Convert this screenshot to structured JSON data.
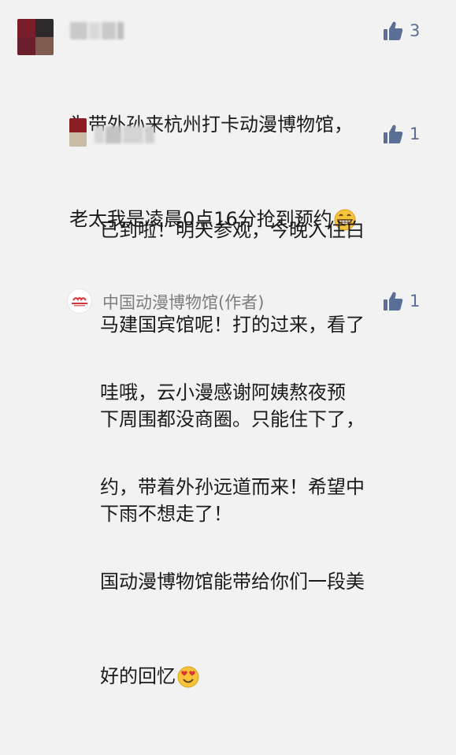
{
  "comments": [
    {
      "like_count": "3",
      "lines": [
        "为带外孙来杭州打卡动漫博物馆，",
        "老太我是凌晨0点16分抢到预约"
      ],
      "emoji": "grinning-emoji"
    },
    {
      "like_count": "1",
      "lines": [
        "已到啦！明天参观，今晚入住白",
        "马建国宾馆呢！打的过来，看了",
        "下周围都没商圈。只能住下了，",
        "下雨不想走了！"
      ]
    },
    {
      "author": "中国动漫博物馆(作者)",
      "like_count": "1",
      "lines": [
        "哇哦，云小漫感谢阿姨熬夜预",
        "约，带着外孙远道而来！希望中",
        "国动漫博物馆能带给你们一段美",
        "好的回忆"
      ],
      "emoji": "heart-eyes-emoji"
    }
  ],
  "icons": {
    "like": "thumbs-up-icon"
  },
  "colors": {
    "background": "#f2f2f2",
    "like_blue": "#5a6f96",
    "author_gray": "#7d7d7d"
  }
}
